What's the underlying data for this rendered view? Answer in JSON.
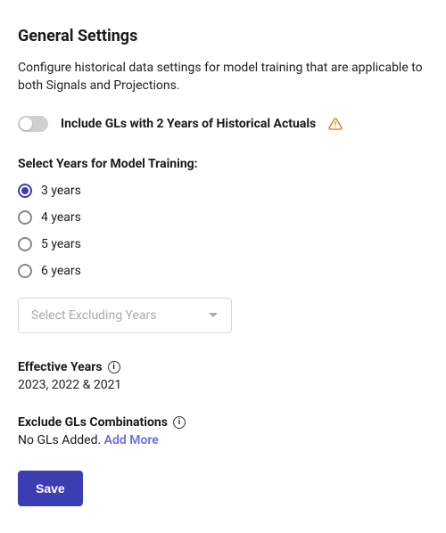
{
  "title": "General Settings",
  "description": "Configure historical data settings for model training that are applicable to both Signals and Projections.",
  "toggle": {
    "label": "Include GLs with 2 Years of Historical Actuals",
    "value": false
  },
  "training_years": {
    "label": "Select Years for Model Training:",
    "options": [
      "3 years",
      "4 years",
      "5 years",
      "6 years"
    ],
    "selected_index": 0
  },
  "exclude_select": {
    "placeholder": "Select Excluding Years"
  },
  "effective_years": {
    "label": "Effective Years",
    "value": "2023, 2022 & 2021"
  },
  "exclude_gls": {
    "label": "Exclude GLs Combinations",
    "empty_text": "No GLs Added.",
    "add_more_label": "Add More"
  },
  "save_label": "Save",
  "info_glyph": "i",
  "colors": {
    "primary": "#3d3db3",
    "link": "#6b6be0",
    "warning": "#d97a00"
  }
}
